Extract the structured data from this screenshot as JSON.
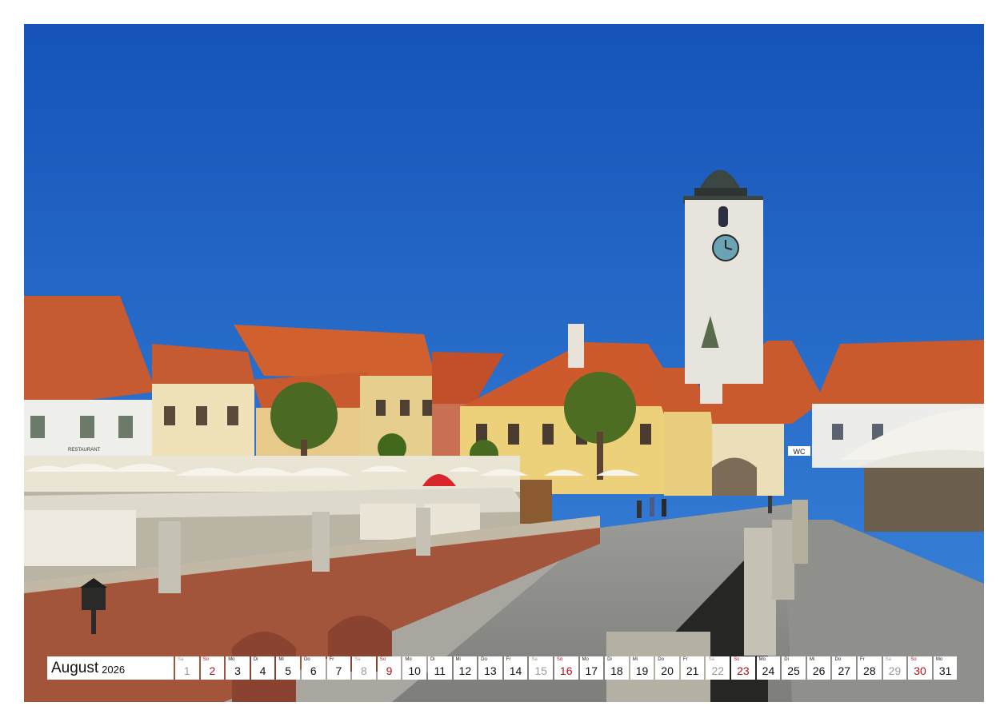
{
  "calendar": {
    "month": "August",
    "year": "2026",
    "days": [
      {
        "wd": "Sa",
        "n": "1",
        "kind": "sat"
      },
      {
        "wd": "So",
        "n": "2",
        "kind": "sun"
      },
      {
        "wd": "Mo",
        "n": "3",
        "kind": "week"
      },
      {
        "wd": "Di",
        "n": "4",
        "kind": "week"
      },
      {
        "wd": "Mi",
        "n": "5",
        "kind": "week"
      },
      {
        "wd": "Do",
        "n": "6",
        "kind": "week"
      },
      {
        "wd": "Fr",
        "n": "7",
        "kind": "week"
      },
      {
        "wd": "Sa",
        "n": "8",
        "kind": "sat"
      },
      {
        "wd": "So",
        "n": "9",
        "kind": "sun"
      },
      {
        "wd": "Mo",
        "n": "10",
        "kind": "week"
      },
      {
        "wd": "Di",
        "n": "11",
        "kind": "week"
      },
      {
        "wd": "Mi",
        "n": "12",
        "kind": "week"
      },
      {
        "wd": "Do",
        "n": "13",
        "kind": "week"
      },
      {
        "wd": "Fr",
        "n": "14",
        "kind": "week"
      },
      {
        "wd": "Sa",
        "n": "15",
        "kind": "sat"
      },
      {
        "wd": "So",
        "n": "16",
        "kind": "sun"
      },
      {
        "wd": "Mo",
        "n": "17",
        "kind": "week"
      },
      {
        "wd": "Di",
        "n": "18",
        "kind": "week"
      },
      {
        "wd": "Mi",
        "n": "19",
        "kind": "week"
      },
      {
        "wd": "Do",
        "n": "20",
        "kind": "week"
      },
      {
        "wd": "Fr",
        "n": "21",
        "kind": "week"
      },
      {
        "wd": "Sa",
        "n": "22",
        "kind": "sat"
      },
      {
        "wd": "So",
        "n": "23",
        "kind": "sun"
      },
      {
        "wd": "Mo",
        "n": "24",
        "kind": "week"
      },
      {
        "wd": "Di",
        "n": "25",
        "kind": "week"
      },
      {
        "wd": "Mi",
        "n": "26",
        "kind": "week"
      },
      {
        "wd": "Do",
        "n": "27",
        "kind": "week"
      },
      {
        "wd": "Fr",
        "n": "28",
        "kind": "week"
      },
      {
        "wd": "Sa",
        "n": "29",
        "kind": "sat"
      },
      {
        "wd": "So",
        "n": "30",
        "kind": "sun"
      },
      {
        "wd": "Mo",
        "n": "31",
        "kind": "week"
      }
    ]
  },
  "photo": {
    "signs": {
      "wc": "WC",
      "restaurant": "RESTAURANT"
    }
  },
  "colors": {
    "sky": "#1b5fc2",
    "roof": "#c85a2e",
    "sunday": "#b0121b",
    "saturday": "#9a9a9a"
  }
}
